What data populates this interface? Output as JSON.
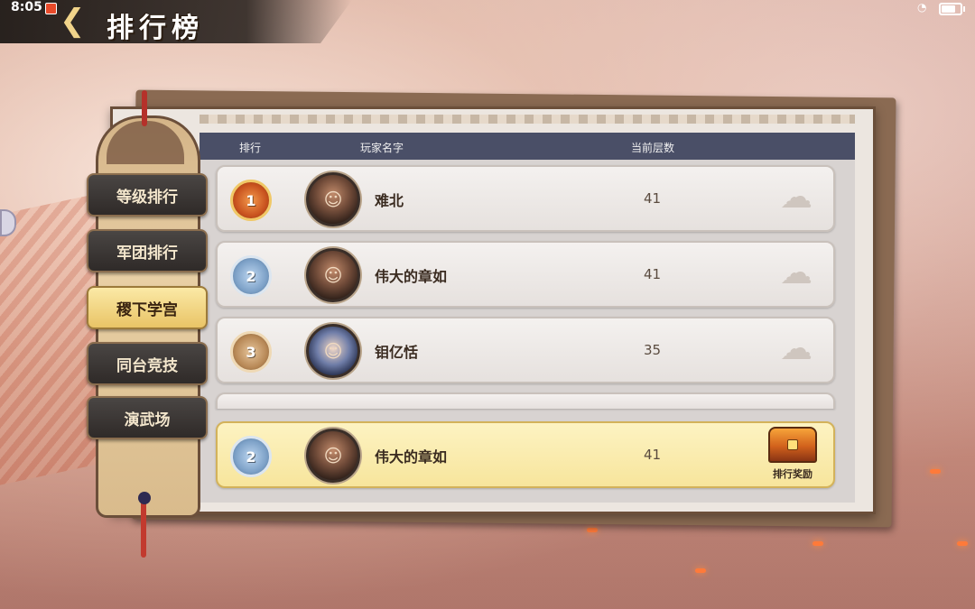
{
  "status_bar": {
    "time": "8:05",
    "battery_level": 0.85
  },
  "header": {
    "title": "排行榜"
  },
  "tabs": [
    {
      "label": "等级排行",
      "active": false
    },
    {
      "label": "军团排行",
      "active": false
    },
    {
      "label": "稷下学宫",
      "active": true
    },
    {
      "label": "同台竞技",
      "active": false
    },
    {
      "label": "演武场",
      "active": false
    }
  ],
  "table": {
    "columns": {
      "rank": "排行",
      "player_name": "玩家名字",
      "floor": "当前层数"
    },
    "rows": [
      {
        "rank": "1",
        "name": "难北",
        "floor": "41"
      },
      {
        "rank": "2",
        "name": "伟大的章如",
        "floor": "41"
      },
      {
        "rank": "3",
        "name": "钼亿恬",
        "floor": "35"
      }
    ]
  },
  "my_rank": {
    "rank": "2",
    "name": "伟大的章如",
    "floor": "41",
    "reward_label": "排行奖励"
  },
  "colors": {
    "header_bg": "#4a4f67",
    "my_row_bg": "#f7e59c",
    "active_tab_bg": "#e9c466"
  }
}
